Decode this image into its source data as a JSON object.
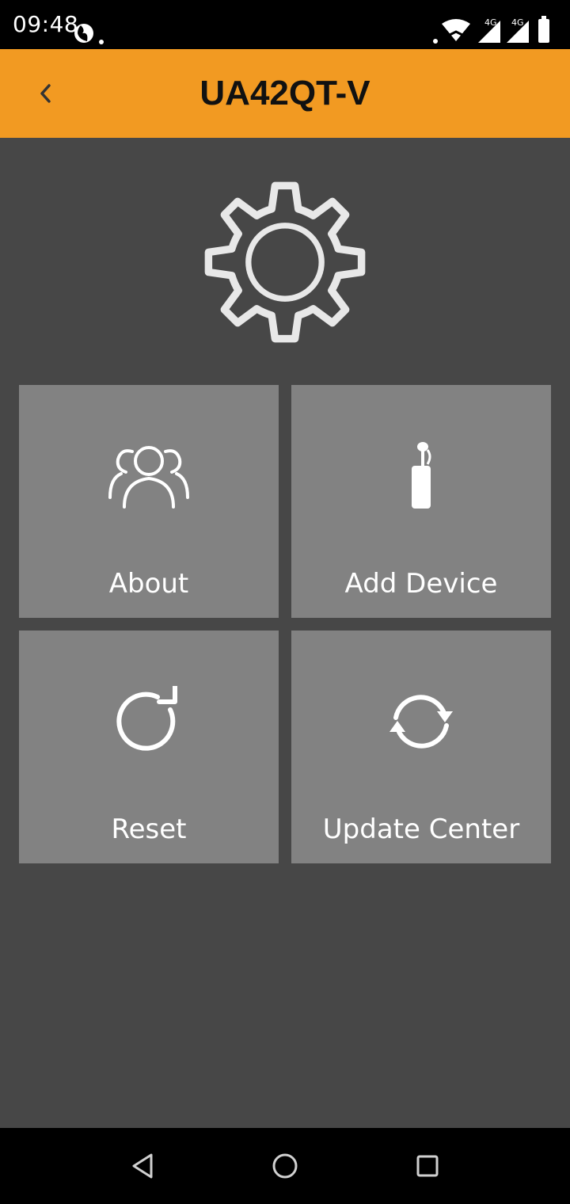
{
  "status_bar": {
    "time": "09:48",
    "icons": [
      "app-notification-icon",
      "wifi-icon",
      "signal-4g-icon",
      "signal-4g-icon",
      "battery-icon"
    ],
    "network_labels": [
      "4G",
      "4G"
    ]
  },
  "header": {
    "title": "UA42QT-V",
    "back_icon": "chevron-left-icon",
    "background_color": "#f29a22"
  },
  "hero": {
    "icon": "settings-gear-icon"
  },
  "tiles": [
    {
      "label": "About",
      "icon": "users-icon"
    },
    {
      "label": "Add Device",
      "icon": "earpiece-device-icon"
    },
    {
      "label": "Reset",
      "icon": "reset-icon"
    },
    {
      "label": "Update Center",
      "icon": "sync-icon"
    }
  ],
  "nav_bar": {
    "icons": [
      "nav-back-icon",
      "nav-home-icon",
      "nav-recents-icon"
    ]
  },
  "colors": {
    "background": "#474747",
    "tile": "#828282",
    "accent": "#f29a22"
  }
}
